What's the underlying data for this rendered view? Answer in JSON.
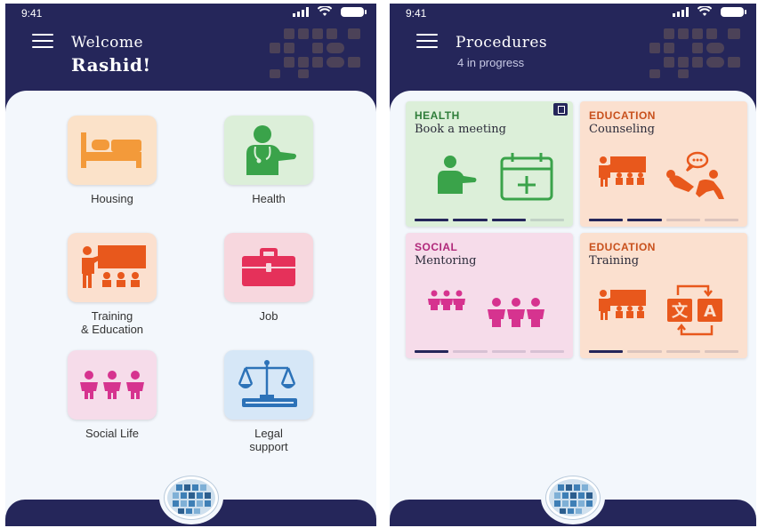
{
  "status": {
    "time": "9:41"
  },
  "home": {
    "greeting": "Welcome",
    "name": "Rashid!",
    "tiles": [
      {
        "label": "Housing",
        "icon": "bed-icon",
        "bg": "#fbe2c9"
      },
      {
        "label": "Health",
        "icon": "doctor-icon",
        "bg": "#dcefd9"
      },
      {
        "label": "Training\n& Education",
        "icon": "classroom-icon",
        "bg": "#fbe0cf"
      },
      {
        "label": "Job",
        "icon": "briefcase-icon",
        "bg": "#f7d7de"
      },
      {
        "label": "Social Life",
        "icon": "people-icon",
        "bg": "#f6dcea"
      },
      {
        "label": "Legal\nsupport",
        "icon": "scales-icon",
        "bg": "#d6e7f7"
      }
    ]
  },
  "procedures": {
    "title": "Procedures",
    "subtitle": "4 in progress",
    "cards": [
      {
        "category": "HEALTH",
        "title": "Book a meeting",
        "cat_color": "#2f7d3a",
        "bg": "#dcefd9",
        "progress": 3,
        "steps": 4,
        "bar_color": "#25265a",
        "icon": "doctor-calendar-icon"
      },
      {
        "category": "EDUCATION",
        "title": "Counseling",
        "cat_color": "#c8501c",
        "bg": "#fbe0cf",
        "progress": 2,
        "steps": 4,
        "bar_color": "#25265a",
        "icon": "counseling-icon"
      },
      {
        "category": "SOCIAL",
        "title": "Mentoring",
        "cat_color": "#b0287a",
        "bg": "#f6dcea",
        "progress": 1,
        "steps": 4,
        "bar_color": "#25265a",
        "icon": "mentoring-icon"
      },
      {
        "category": "EDUCATION",
        "title": "Training",
        "cat_color": "#c8501c",
        "bg": "#fbe0cf",
        "progress": 1,
        "steps": 4,
        "bar_color": "#25265a",
        "icon": "translation-icon"
      }
    ]
  },
  "colors": {
    "navy": "#25265a",
    "orange": "#e8581c",
    "green": "#3aa34a",
    "pink": "#d6338f",
    "red": "#e5315a",
    "blue": "#2c72b8"
  }
}
